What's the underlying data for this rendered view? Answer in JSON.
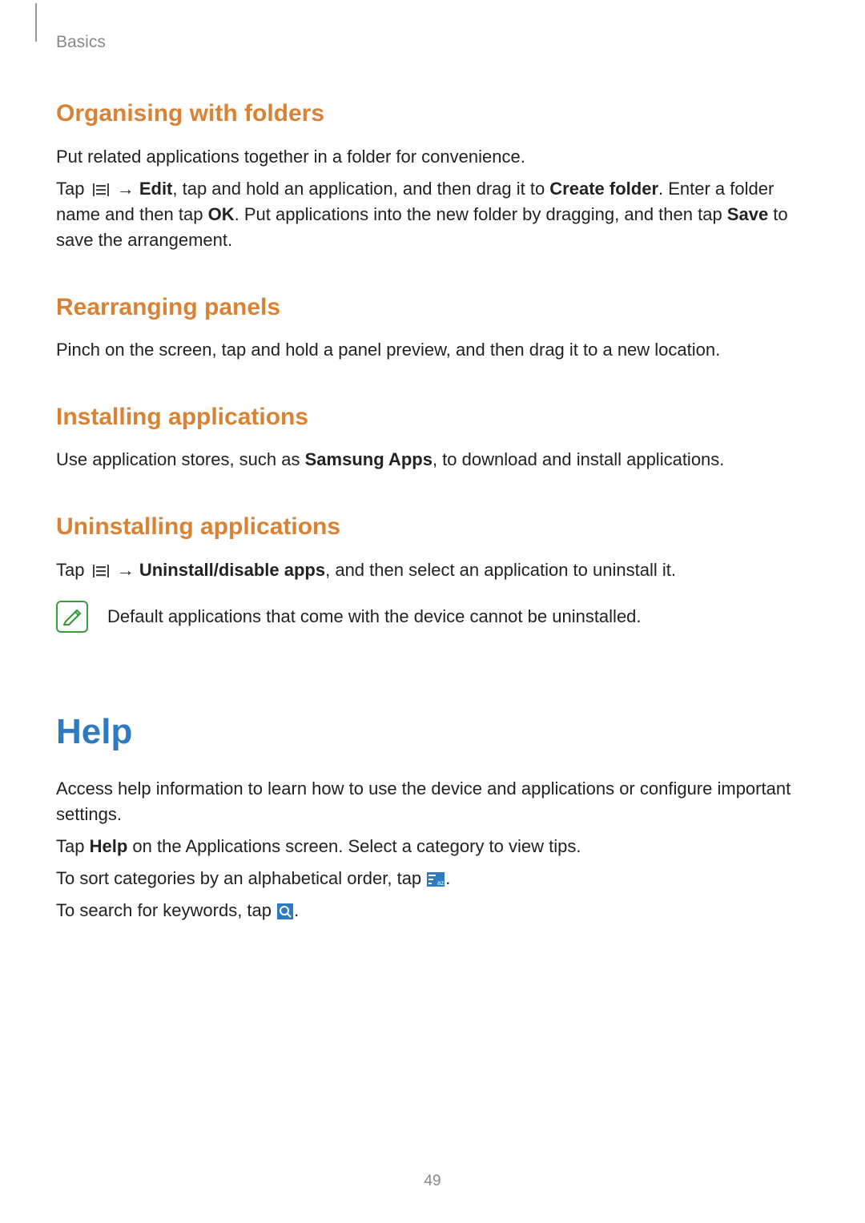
{
  "breadcrumb": "Basics",
  "page_number": "49",
  "sections": {
    "organising": {
      "heading": "Organising with folders",
      "p1": "Put related applications together in a folder for convenience.",
      "p2a": "Tap ",
      "p2_arrow": " → ",
      "p2_edit": "Edit",
      "p2b": ", tap and hold an application, and then drag it to ",
      "p2_create_folder": "Create folder",
      "p2c": ". Enter a folder name and then tap ",
      "p2_ok": "OK",
      "p2d": ". Put applications into the new folder by dragging, and then tap ",
      "p2_save": "Save",
      "p2e": " to save the arrangement."
    },
    "rearranging": {
      "heading": "Rearranging panels",
      "p1": "Pinch on the screen, tap and hold a panel preview, and then drag it to a new location."
    },
    "installing": {
      "heading": "Installing applications",
      "p1a": "Use application stores, such as ",
      "p1_bold": "Samsung Apps",
      "p1b": ", to download and install applications."
    },
    "uninstalling": {
      "heading": "Uninstalling applications",
      "p1a": "Tap ",
      "p1_arrow": " → ",
      "p1_bold": "Uninstall/disable apps",
      "p1b": ", and then select an application to uninstall it.",
      "note": "Default applications that come with the device cannot be uninstalled."
    },
    "help": {
      "heading": "Help",
      "p1": "Access help information to learn how to use the device and applications or configure important settings.",
      "p2a": "Tap ",
      "p2_bold": "Help",
      "p2b": " on the Applications screen. Select a category to view tips.",
      "p3a": "To sort categories by an alphabetical order, tap ",
      "p3b": ".",
      "p4a": "To search for keywords, tap ",
      "p4b": "."
    }
  }
}
